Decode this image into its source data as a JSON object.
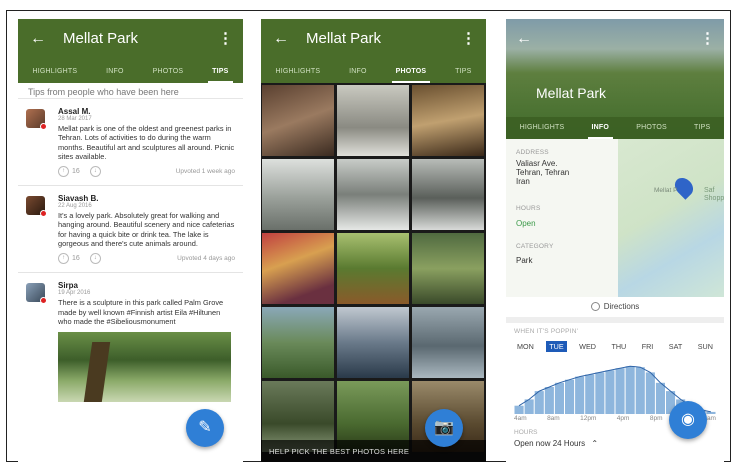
{
  "screen1": {
    "title": "Mellat Park",
    "tabs": [
      "HIGHLIGHTS",
      "INFO",
      "PHOTOS",
      "TIPS"
    ],
    "active_tab": "TIPS",
    "hint": "Tips from people who have been here",
    "tips": [
      {
        "name": "Assal M.",
        "date": "28 Mar 2017",
        "text": "Mellat park is one of the oldest and greenest parks in Tehran. Lots of activities to do during the warm months. Beautiful art and sculptures all around. Picnic sites available.",
        "upvotes": "16",
        "upvoted": "Upvoted 1 week ago"
      },
      {
        "name": "Siavash B.",
        "date": "22 Aug 2016",
        "text": "It's a lovely park. Absolutely great for walking and hanging around. Beautiful scenery and nice cafeterias for having a quick bite or drink tea. The lake is gorgeous and there's cute animals around.",
        "upvotes": "16",
        "upvoted": "Upvoted 4 days ago"
      },
      {
        "name": "Sirpa",
        "date": "19 Apr 2016",
        "text": "There is a sculpture in this park called Palm Grove made by well known #Finnish artist Eila #Hiltunen who made the #Sibeliousmonument"
      }
    ]
  },
  "screen2": {
    "title": "Mellat Park",
    "tabs": [
      "HIGHLIGHTS",
      "INFO",
      "PHOTOS",
      "TIPS"
    ],
    "active_tab": "PHOTOS",
    "help_text": "HELP PICK THE BEST PHOTOS HERE"
  },
  "screen3": {
    "title": "Mellat Park",
    "tabs": [
      "HIGHLIGHTS",
      "INFO",
      "PHOTOS",
      "TIPS"
    ],
    "active_tab": "INFO",
    "address_label": "ADDRESS",
    "address": [
      "Valiasr Ave.",
      "Tehran, Tehran",
      "Iran"
    ],
    "hours_label": "HOURS",
    "hours_value": "Open",
    "category_label": "CATEGORY",
    "category_value": "Park",
    "map_label": "Mellat P",
    "map_label2": "Saf\nShopping",
    "directions": "Directions",
    "popping_label": "WHEN IT'S POPPIN'",
    "days": [
      "MON",
      "TUE",
      "WED",
      "THU",
      "FRI",
      "SAT",
      "SUN"
    ],
    "selected_day": "TUE",
    "hour_ticks": [
      "4am",
      "8am",
      "12pm",
      "4pm",
      "8pm",
      "",
      "4am"
    ],
    "hours2_label": "HOURS",
    "open_now": "Open now",
    "open_hours": "24 Hours",
    "colors": {
      "bar": "#8eb6dd",
      "line": "#2f64a8",
      "highlight": "#1e5bb8"
    }
  },
  "colors": {
    "appbar": "#4a6d2a",
    "fab": "#2f7fd6"
  },
  "icons": [
    "back-arrow-icon",
    "overflow-menu-icon",
    "upvote-icon",
    "downvote-icon",
    "add-tip-icon",
    "add-photo-icon",
    "directions-icon",
    "check-in-icon",
    "heart-icon",
    "map-pin-icon"
  ],
  "chart_data": {
    "type": "line",
    "title": "",
    "categories": [
      "4am",
      "8am",
      "12pm",
      "4pm",
      "8pm",
      "",
      "4am"
    ],
    "series": [
      {
        "values": [
          8,
          14,
          22,
          26,
          30,
          33,
          36,
          38,
          40,
          42,
          44,
          46,
          45,
          40,
          30,
          22,
          14,
          8,
          4,
          2
        ]
      }
    ],
    "ylim": [
      0,
      50
    ],
    "grid": false
  }
}
